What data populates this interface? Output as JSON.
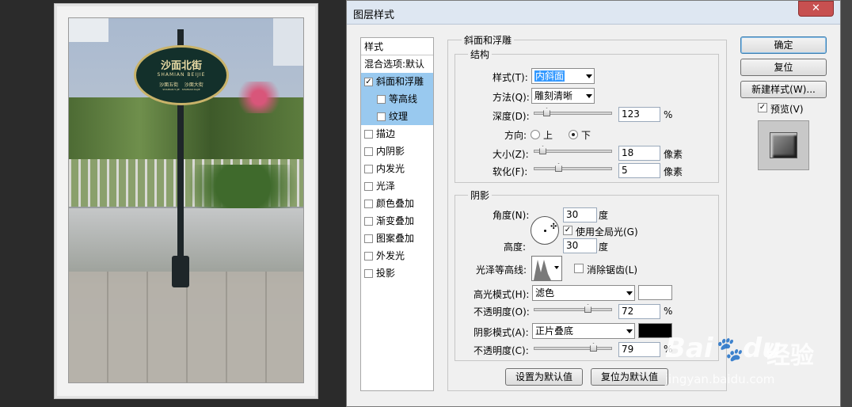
{
  "canvas": {
    "sign": {
      "title": "沙面北街",
      "subtitle": "SHAMIAN BEIJIE",
      "line_left": "沙面五街",
      "line_right": "沙面大街",
      "small_left": "SHAMIAN 5 JIE",
      "small_right": "SHAMIAN DAJIE"
    }
  },
  "dialog": {
    "title": "图层样式",
    "close": "✕",
    "style_list": {
      "header": "样式",
      "blend_default": "混合选项:默认",
      "items": [
        {
          "label": "斜面和浮雕",
          "checked": true,
          "selected": true
        },
        {
          "label": "等高线",
          "checked": false,
          "selected": true,
          "sub": true
        },
        {
          "label": "纹理",
          "checked": false,
          "selected": true,
          "sub": true
        },
        {
          "label": "描边",
          "checked": false
        },
        {
          "label": "内阴影",
          "checked": false
        },
        {
          "label": "内发光",
          "checked": false
        },
        {
          "label": "光泽",
          "checked": false
        },
        {
          "label": "颜色叠加",
          "checked": false
        },
        {
          "label": "渐变叠加",
          "checked": false
        },
        {
          "label": "图案叠加",
          "checked": false
        },
        {
          "label": "外发光",
          "checked": false
        },
        {
          "label": "投影",
          "checked": false
        }
      ]
    },
    "bevel": {
      "title": "斜面和浮雕",
      "structure": {
        "title": "结构",
        "style_label": "样式(T):",
        "style_value": "内斜面",
        "technique_label": "方法(Q):",
        "technique_value": "雕刻清晰",
        "depth_label": "深度(D):",
        "depth_value": "123",
        "depth_unit": "%",
        "depth_fraction": 0.12,
        "direction_label": "方向:",
        "dir_up": "上",
        "dir_down": "下",
        "direction": "下",
        "size_label": "大小(Z):",
        "size_value": "18",
        "size_unit": "像素",
        "size_fraction": 0.07,
        "soften_label": "软化(F):",
        "soften_value": "5",
        "soften_unit": "像素",
        "soften_fraction": 0.3
      },
      "shading": {
        "title": "阴影",
        "angle_label": "角度(N):",
        "angle_value": "30",
        "angle_unit": "度",
        "global_light": "使用全局光(G)",
        "global_light_checked": true,
        "altitude_label": "高度:",
        "altitude_value": "30",
        "altitude_unit": "度",
        "gloss_label": "光泽等高线:",
        "antialias": "消除锯齿(L)",
        "antialias_checked": false,
        "highlight_label": "高光模式(H):",
        "highlight_mode": "滤色",
        "highlight_color": "#ffffff",
        "hl_opacity_label": "不透明度(O):",
        "hl_opacity_value": "72",
        "hl_opacity_unit": "%",
        "hl_opacity_fraction": 0.72,
        "shadow_label": "阴影模式(A):",
        "shadow_mode": "正片叠底",
        "shadow_color": "#000000",
        "sh_opacity_label": "不透明度(C):",
        "sh_opacity_value": "79",
        "sh_opacity_unit": "%",
        "sh_opacity_fraction": 0.79
      },
      "make_default": "设置为默认值",
      "reset_default": "复位为默认值"
    },
    "buttons": {
      "ok": "确定",
      "reset": "复位",
      "new_style": "新建样式(W)...",
      "preview": "预览(V)",
      "preview_checked": true
    }
  },
  "watermark": {
    "brand": "Bai",
    "brand2": "du",
    "cn": "经验",
    "url": "jingyan.baidu.com"
  }
}
